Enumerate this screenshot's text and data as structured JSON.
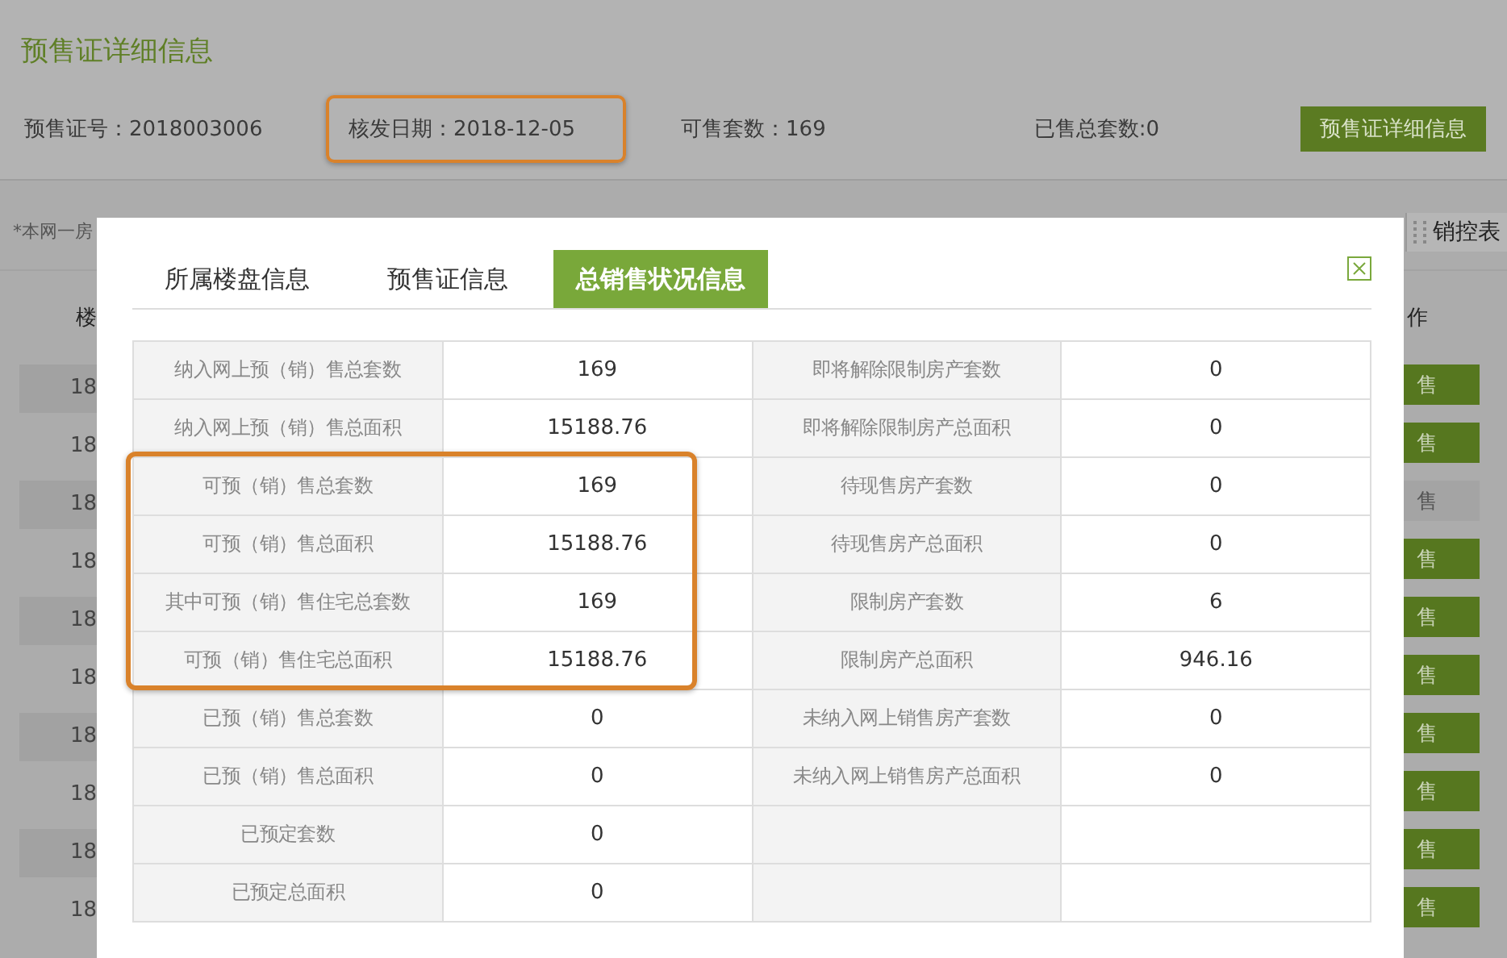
{
  "header": {
    "title": "预售证详细信息",
    "button": "预售证详细信息",
    "fields": [
      {
        "label": "预售证号：",
        "value": "2018003006",
        "highlighted": false
      },
      {
        "label": "核发日期：",
        "value": "2018-12-05",
        "highlighted": true
      },
      {
        "label": "可售套数：",
        "value": "169",
        "highlighted": false
      },
      {
        "label": "已售总套数:",
        "value": "0",
        "highlighted": false
      }
    ]
  },
  "notice": "*本网一房",
  "control_table_button": "销控表",
  "list": {
    "column_1": "楼",
    "column_2": "作",
    "rows": [
      {
        "column_1": "18",
        "action": "售",
        "enabled": true
      },
      {
        "column_1": "18",
        "action": "售",
        "enabled": true
      },
      {
        "column_1": "18",
        "action": "售",
        "enabled": false
      },
      {
        "column_1": "18",
        "action": "售",
        "enabled": true
      },
      {
        "column_1": "18",
        "action": "售",
        "enabled": true
      },
      {
        "column_1": "18",
        "action": "售",
        "enabled": true
      },
      {
        "column_1": "18",
        "action": "售",
        "enabled": true
      },
      {
        "column_1": "18",
        "action": "售",
        "enabled": true
      },
      {
        "column_1": "18",
        "action": "售",
        "enabled": true
      },
      {
        "column_1": "18",
        "action": "售",
        "enabled": true
      }
    ]
  },
  "modal": {
    "tabs": [
      {
        "label": "所属楼盘信息",
        "selected": false
      },
      {
        "label": "预售证信息",
        "selected": false
      },
      {
        "label": "总销售状况信息",
        "selected": true
      }
    ],
    "rows": [
      {
        "label_1": "纳入网上预（销）售总套数",
        "value_1": "169",
        "label_2": "即将解除限制房产套数",
        "value_2": "0",
        "highlighted": false
      },
      {
        "label_1": "纳入网上预（销）售总面积",
        "value_1": "15188.76",
        "label_2": "即将解除限制房产总面积",
        "value_2": "0",
        "highlighted": false
      },
      {
        "label_1": "可预（销）售总套数",
        "value_1": "169",
        "label_2": "待现售房产套数",
        "value_2": "0",
        "highlighted": true
      },
      {
        "label_1": "可预（销）售总面积",
        "value_1": "15188.76",
        "label_2": "待现售房产总面积",
        "value_2": "0",
        "highlighted": true
      },
      {
        "label_1": "其中可预（销）售住宅总套数",
        "value_1": "169",
        "label_2": "限制房产套数",
        "value_2": "6",
        "highlighted": true
      },
      {
        "label_1": "可预（销）售住宅总面积",
        "value_1": "15188.76",
        "label_2": "限制房产总面积",
        "value_2": "946.16",
        "highlighted": true
      },
      {
        "label_1": "已预（销）售总套数",
        "value_1": "0",
        "label_2": "未纳入网上销售房产套数",
        "value_2": "0",
        "highlighted": false
      },
      {
        "label_1": "已预（销）售总面积",
        "value_1": "0",
        "label_2": "未纳入网上销售房产总面积",
        "value_2": "0",
        "highlighted": false
      },
      {
        "label_1": "已预定套数",
        "value_1": "0",
        "highlighted": false
      },
      {
        "label_1": "已预定总面积",
        "value_1": "0",
        "highlighted": false
      }
    ]
  }
}
